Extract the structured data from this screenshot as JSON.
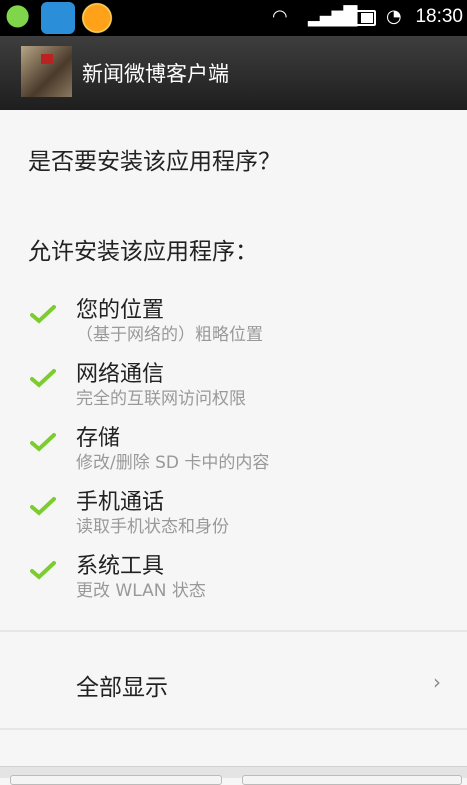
{
  "status_bar": {
    "notification_icons": [
      "wechat-icon",
      "cloud-app-icon",
      "sun-app-icon"
    ],
    "icons": [
      "wifi-icon",
      "signal-icon",
      "battery-icon",
      "alarm-icon"
    ],
    "time": "18:30"
  },
  "header": {
    "app_title": "新闻微博客户端",
    "avatar": "app-avatar"
  },
  "main": {
    "question": "是否要安装该应用程序？",
    "allow_heading": "允许安装该应用程序：",
    "permissions": [
      {
        "title": "您的位置",
        "desc": "（基于网络的）粗略位置"
      },
      {
        "title": "网络通信",
        "desc": "完全的互联网访问权限"
      },
      {
        "title": "存储",
        "desc": "修改/删除 SD 卡中的内容"
      },
      {
        "title": "手机通话",
        "desc": "读取手机状态和身份"
      },
      {
        "title": "系统工具",
        "desc": "更改 WLAN 状态"
      }
    ],
    "show_all": "全部显示"
  },
  "colors": {
    "check": "#7ccc2e",
    "titlebar": "#2a2a2a"
  }
}
